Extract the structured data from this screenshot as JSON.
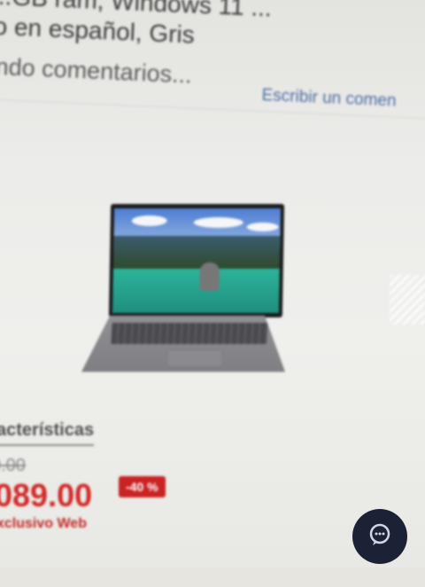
{
  "product": {
    "title_line1": "...GB ram, Windows 11 ...",
    "title_line2": "o en español, Gris",
    "reviews_text": "ndo comentarios...",
    "write_review_label": "Escribir un comen"
  },
  "image": {
    "alt": "Laptop product image"
  },
  "features": {
    "heading": "acterísticas"
  },
  "pricing": {
    "old_price": "9.00",
    "price": "089.00",
    "discount_badge": "-40 %",
    "exclusive_label": "xclusivo Web"
  },
  "chat": {
    "icon": "chat-icon"
  },
  "colors": {
    "price_red": "#d12a2a",
    "badge_red": "#c92323",
    "link_blue": "#4c6ea5",
    "chat_navy": "#1b2235"
  }
}
